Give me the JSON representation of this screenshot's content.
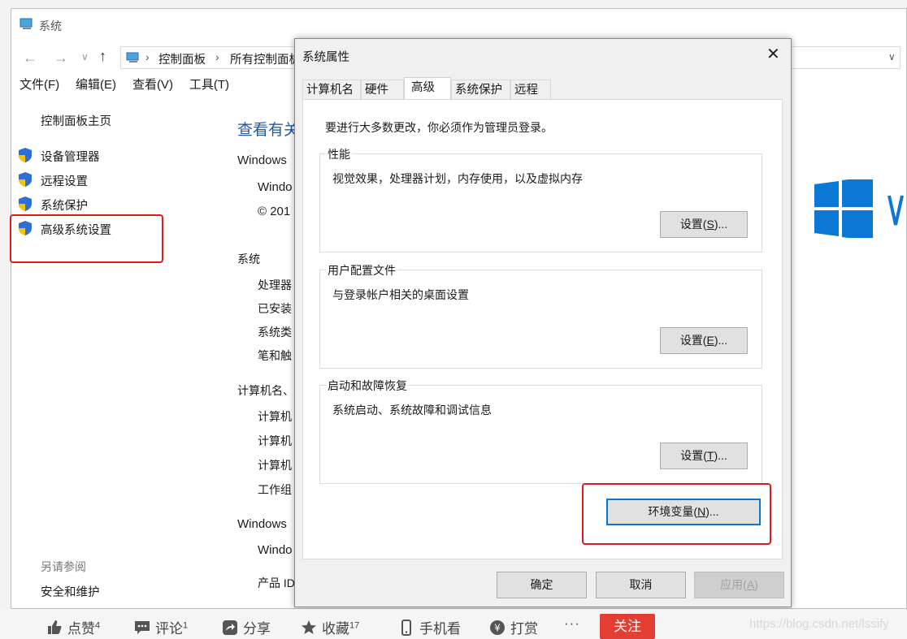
{
  "system_window": {
    "title": "系统",
    "breadcrumb": [
      "控制面板",
      "所有控制面板"
    ],
    "menu": [
      "文件(F)",
      "编辑(E)",
      "查看(V)",
      "工具(T)"
    ],
    "sidebar": {
      "home": "控制面板主页",
      "items": [
        "设备管理器",
        "远程设置",
        "系统保护",
        "高级系统设置"
      ],
      "see_also_title": "另请参阅",
      "see_also_item": "安全和维护"
    },
    "main": {
      "heading": "查看有关",
      "sections": [
        {
          "title": "Windows",
          "rows": [
            "Windo",
            "© 201"
          ]
        },
        {
          "title": "系统",
          "rows": [
            "处理器",
            "已安装",
            "系统类",
            "笔和触"
          ]
        },
        {
          "title": "计算机名、",
          "rows": [
            "计算机",
            "计算机",
            "计算机",
            "工作组"
          ]
        },
        {
          "title": "Windows",
          "rows": [
            "Windo",
            "产品 ID"
          ]
        }
      ]
    }
  },
  "dialog": {
    "title": "系统属性",
    "tabs": [
      "计算机名",
      "硬件",
      "高级",
      "系统保护",
      "远程"
    ],
    "active_tab": "高级",
    "admin_note": "要进行大多数更改，你必须作为管理员登录。",
    "groups": [
      {
        "title": "性能",
        "desc": "视觉效果，处理器计划，内存使用，以及虚拟内存",
        "btn_pre": "设置(",
        "btn_key": "S",
        "btn_post": ")..."
      },
      {
        "title": "用户配置文件",
        "desc": "与登录帐户相关的桌面设置",
        "btn_pre": "设置(",
        "btn_key": "E",
        "btn_post": ")..."
      },
      {
        "title": "启动和故障恢复",
        "desc": "系统启动、系统故障和调试信息",
        "btn_pre": "设置(",
        "btn_key": "T",
        "btn_post": ")..."
      }
    ],
    "env_pre": "环境变量(",
    "env_key": "N",
    "env_post": ")...",
    "ok": "确定",
    "cancel": "取消",
    "apply_pre": "应用(",
    "apply_key": "A",
    "apply_post": ")"
  },
  "bottom_bar": {
    "like": "点赞",
    "like_count": "4",
    "comment": "评论",
    "comment_count": "1",
    "share": "分享",
    "favorite": "收藏",
    "favorite_count": "17",
    "mobile": "手机看",
    "reward": "打赏",
    "more": "···",
    "follow": "关注",
    "watermark": "https://blog.csdn.net/lssify"
  },
  "colors": {
    "accent": "#0078d7",
    "highlight": "#e01a1a",
    "follow_bg": "#e33e33",
    "win_logo": "#0078d7"
  }
}
